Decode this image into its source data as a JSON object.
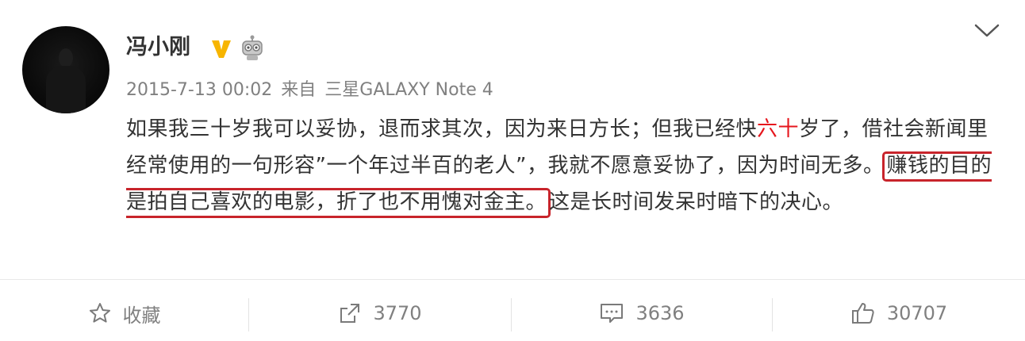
{
  "user": {
    "name": "冯小刚"
  },
  "meta": {
    "time": "2015-7-13 00:02",
    "from": "来自",
    "device": "三星GALAXY Note 4"
  },
  "content": {
    "p1": "如果我三十岁我可以妥协，退而求其次，因为来日方长；但我已经快",
    "p2_red": "六十",
    "p3": "岁了，借社会新闻里经常使用的一句形容”一个年过半百的老人”，我就不愿意妥协了，因为时间无多。",
    "p4_boxed": "赚钱的目的是拍自己喜欢的电影，折了也不用愧对金主。",
    "p5": "这是长时间发呆时暗下的决心。"
  },
  "actions": {
    "favorite_label": "收藏",
    "share_count": "3770",
    "comment_count": "3636",
    "like_count": "30707"
  },
  "colors": {
    "accent_red": "#e6161d",
    "box_red": "#c8242b",
    "verified": "#f7b500"
  },
  "icons": [
    "chevron-down-icon",
    "verified-icon",
    "robot-icon",
    "star-icon",
    "share-icon",
    "comment-icon",
    "like-icon"
  ]
}
